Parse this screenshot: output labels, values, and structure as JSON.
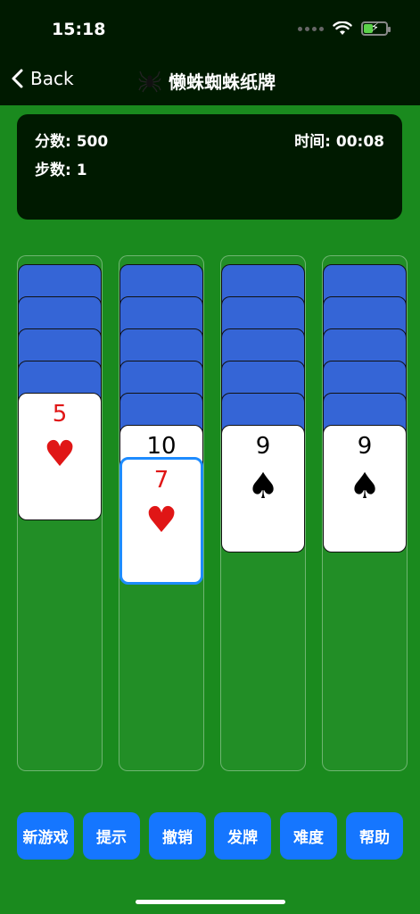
{
  "status_bar": {
    "time": "15:18"
  },
  "nav": {
    "back_label": "Back",
    "title": "懒蛛蜘蛛纸牌"
  },
  "scoreboard": {
    "score": "分数: 500",
    "steps": "步数: 1",
    "time": "时间: 00:08"
  },
  "columns": [
    {
      "hidden": 4,
      "face_cards": [
        {
          "rank": "5",
          "suit": "♥",
          "color": "red",
          "selected": false
        }
      ]
    },
    {
      "hidden": 5,
      "face_cards": [
        {
          "rank": "10",
          "suit": "",
          "color": "black",
          "selected": false
        },
        {
          "rank": "7",
          "suit": "♥",
          "color": "red",
          "selected": true
        }
      ]
    },
    {
      "hidden": 5,
      "face_cards": [
        {
          "rank": "9",
          "suit": "♠",
          "color": "black",
          "selected": false
        }
      ]
    },
    {
      "hidden": 5,
      "face_cards": [
        {
          "rank": "9",
          "suit": "♠",
          "color": "black",
          "selected": false
        }
      ]
    }
  ],
  "buttons": {
    "new_game": "新游戏",
    "hint": "提示",
    "undo": "撤销",
    "deal": "发牌",
    "difficulty": "难度",
    "help": "帮助"
  },
  "colors": {
    "table": "#1a8a1e",
    "card_back": "#3565d6",
    "button": "#1576ff",
    "selected_border": "#1e8cff"
  }
}
